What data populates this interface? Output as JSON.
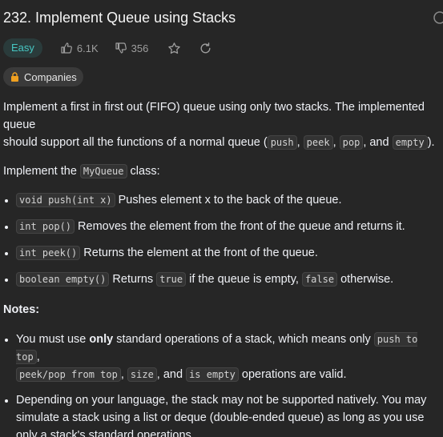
{
  "problem": {
    "title": "232. Implement Queue using Stacks",
    "difficulty": "Easy",
    "likes": "6.1K",
    "dislikes": "356",
    "companies_label": "Companies"
  },
  "description": {
    "intro_a": "Implement a first in first out (FIFO) queue using only two stacks. The implemented queue",
    "intro_b": "should support all the functions of a normal queue (",
    "ops": [
      "push",
      "peek",
      "pop",
      "empty"
    ],
    "sep_1": ", ",
    "sep_2": ", ",
    "sep_3": ", and ",
    "intro_end": ").",
    "impl_a": "Implement the ",
    "impl_code": "MyQueue",
    "impl_b": " class:",
    "methods": [
      {
        "code": "void push(int x)",
        "text": " Pushes element x to the back of the queue."
      },
      {
        "code": "int pop()",
        "text": " Removes the element from the front of the queue and returns it."
      },
      {
        "code": "int peek()",
        "text": " Returns the element at the front of the queue."
      },
      {
        "code": "boolean empty()",
        "text_a": " Returns ",
        "code_b": "true",
        "text_b": " if the queue is empty, ",
        "code_c": "false",
        "text_c": " otherwise."
      }
    ],
    "notes_title": "Notes:",
    "note1": {
      "a": "You must use ",
      "bold": "only",
      "b": " standard operations of a stack, which means only ",
      "code1": "push to top",
      "c": ",",
      "code2": "peek/pop from top",
      "d": ", ",
      "code3": "size",
      "e": ", and ",
      "code4": "is empty",
      "f": " operations are valid."
    },
    "note2": "Depending on your language, the stack may not be supported natively. You may simulate a stack using a list or deque (double-ended queue) as long as you use only a stack's standard operations."
  }
}
